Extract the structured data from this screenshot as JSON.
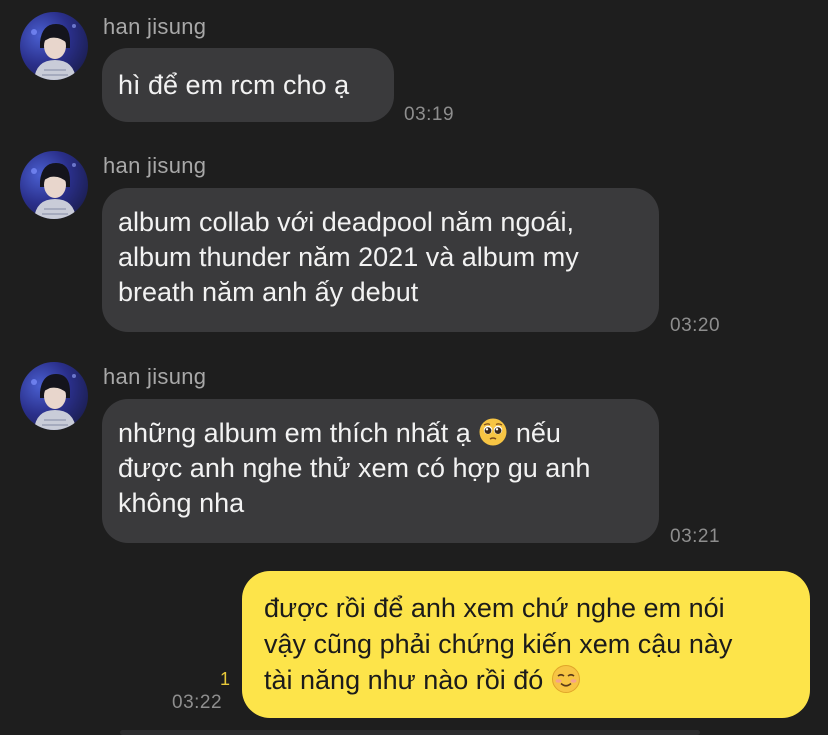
{
  "messages": [
    {
      "sender": "han jisung",
      "text": "hì để em rcm cho ạ",
      "time": "03:19"
    },
    {
      "sender": "han jisung",
      "lines": [
        "album collab với deadpool năm ngoái,",
        "album thunder năm 2021 và album my",
        "breath năm anh ấy debut"
      ],
      "time": "03:20"
    },
    {
      "sender": "han jisung",
      "lines": [
        "những album em thích nhất ạ",
        "nếu",
        "được anh nghe thử xem có hợp gu anh",
        "không nha"
      ],
      "emoji": "pleading-face-emoji",
      "time": "03:21"
    }
  ],
  "outgoing": {
    "lines": [
      "được rồi để anh xem chứ nghe em nói",
      "vậy cũng phải chứng kiến xem cậu này",
      "tài năng như nào rồi đó"
    ],
    "emoji": "smiling-face-emoji",
    "time": "03:22",
    "unread_count": "1",
    "bubble_color": "#fde44a"
  },
  "colors": {
    "background": "#1e1e1e",
    "incoming_bubble": "#3a3a3c",
    "unread": "#e8c93a"
  }
}
